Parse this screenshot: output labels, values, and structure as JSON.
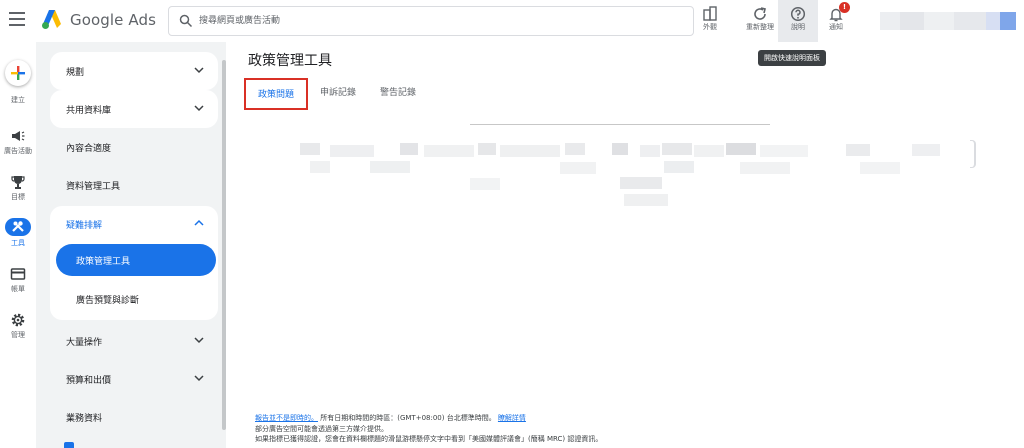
{
  "app": {
    "brand": "Google Ads"
  },
  "search": {
    "placeholder": "搜尋網頁或廣告活動"
  },
  "toolbar": {
    "appearance_label": "外觀",
    "refresh_label": "重新整理",
    "help_label": "說明",
    "notifications_label": "通知",
    "notification_badge": "!",
    "help_tooltip": "開啟快速說明面板"
  },
  "rail": {
    "create_label": "建立",
    "campaigns_label": "廣告活動",
    "goals_label": "目標",
    "tools_label": "工具",
    "billing_label": "帳單",
    "admin_label": "管理"
  },
  "sidebar": {
    "planning": "規劃",
    "shared_library": "共用資料庫",
    "content_suitability": "內容合適度",
    "data_manager": "資料管理工具",
    "troubleshooting": "疑難排解",
    "policy_manager": "政策管理工具",
    "ad_preview": "廣告預覽與診斷",
    "bulk_actions": "大量操作",
    "budgets_bidding": "預算和出價",
    "business_data": "業務資料"
  },
  "main": {
    "title": "政策管理工具",
    "tabs": [
      "政策問題",
      "申訴記錄",
      "警告記錄"
    ]
  },
  "footer": {
    "line1_link": "報告並不是即時的。",
    "line1_text": "所有日期和時間的時區：(GMT+08:00) 台北標準時間。",
    "line1_link2": "瞭解詳情",
    "line2": "部分廣告空間可能會透過第三方媒介提供。",
    "line3": "如果指標已獲得認證，您會在資料欄標題的滑鼠游標懸停文字中看到「美國媒體評議會」(簡稱 MRC) 認證資訊。"
  },
  "colors": {
    "accent": "#1a73e8",
    "alert": "#d93025",
    "sidebar_bg": "#f1f3f4"
  }
}
